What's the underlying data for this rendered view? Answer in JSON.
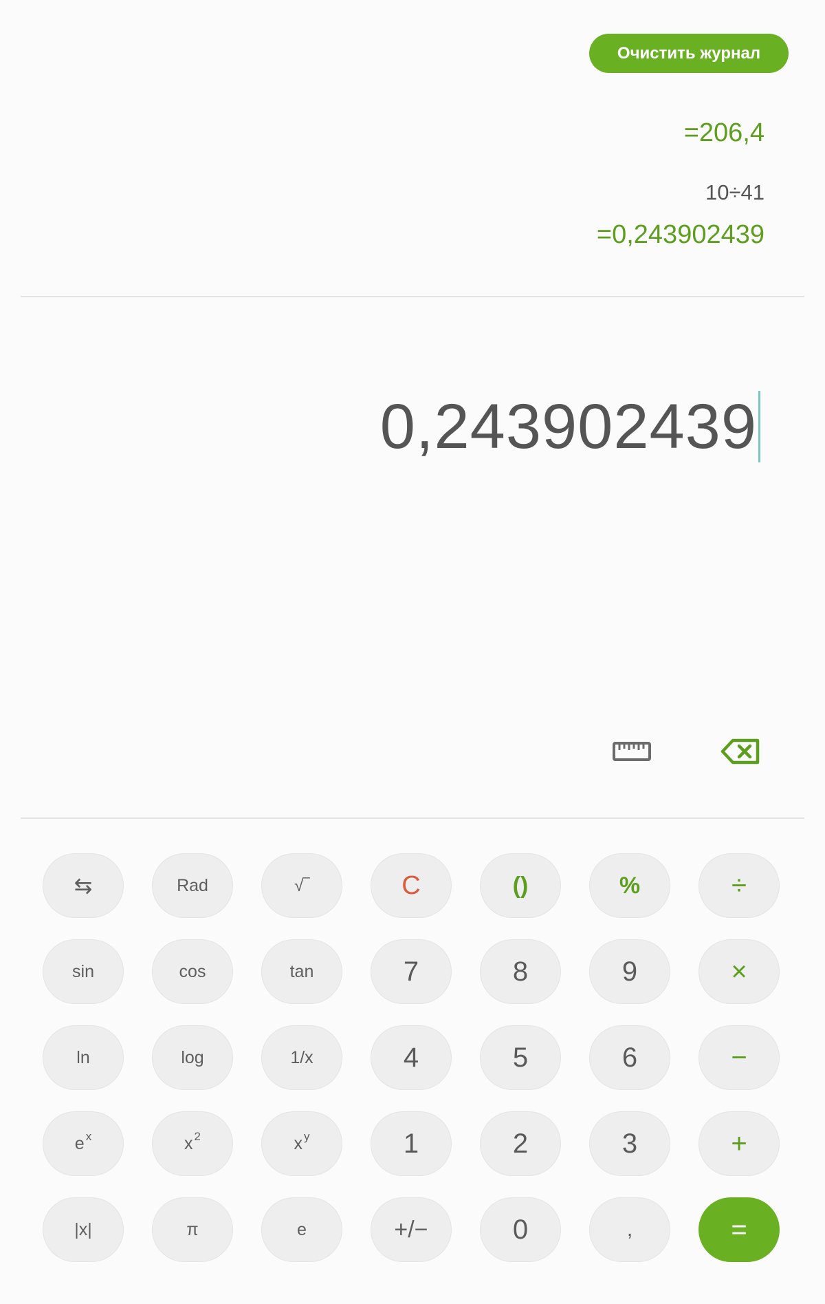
{
  "header": {
    "clear_history_label": "Очистить журнал"
  },
  "history": {
    "items": [
      {
        "result": "=206,4"
      },
      {
        "expression": "10÷41",
        "result": "=0,243902439"
      }
    ]
  },
  "display": {
    "value": "0,243902439"
  },
  "tools": {
    "ruler_icon": "ruler-icon",
    "backspace_icon": "backspace-icon"
  },
  "colors": {
    "accent": "#6ab023",
    "accent_text": "#5d9e1e",
    "clear_key": "#dd5a3e",
    "key_bg": "#eeeeee"
  },
  "keys": {
    "swap": "⇆",
    "rad": "Rad",
    "sqrt": "√‾",
    "clear": "C",
    "parens": "()",
    "percent": "%",
    "divide": "÷",
    "sin": "sin",
    "cos": "cos",
    "tan": "tan",
    "seven": "7",
    "eight": "8",
    "nine": "9",
    "multiply": "×",
    "ln": "ln",
    "log": "log",
    "reciprocal": "1/x",
    "four": "4",
    "five": "5",
    "six": "6",
    "minus": "−",
    "exp_base": "e",
    "exp_sup": "x",
    "square_base": "x",
    "square_sup": "2",
    "power_base": "x",
    "power_sup": "y",
    "one": "1",
    "two": "2",
    "three": "3",
    "plus": "+",
    "abs": "|x|",
    "pi": "π",
    "e": "e",
    "negate": "+/−",
    "zero": "0",
    "comma": ",",
    "equals": "="
  }
}
